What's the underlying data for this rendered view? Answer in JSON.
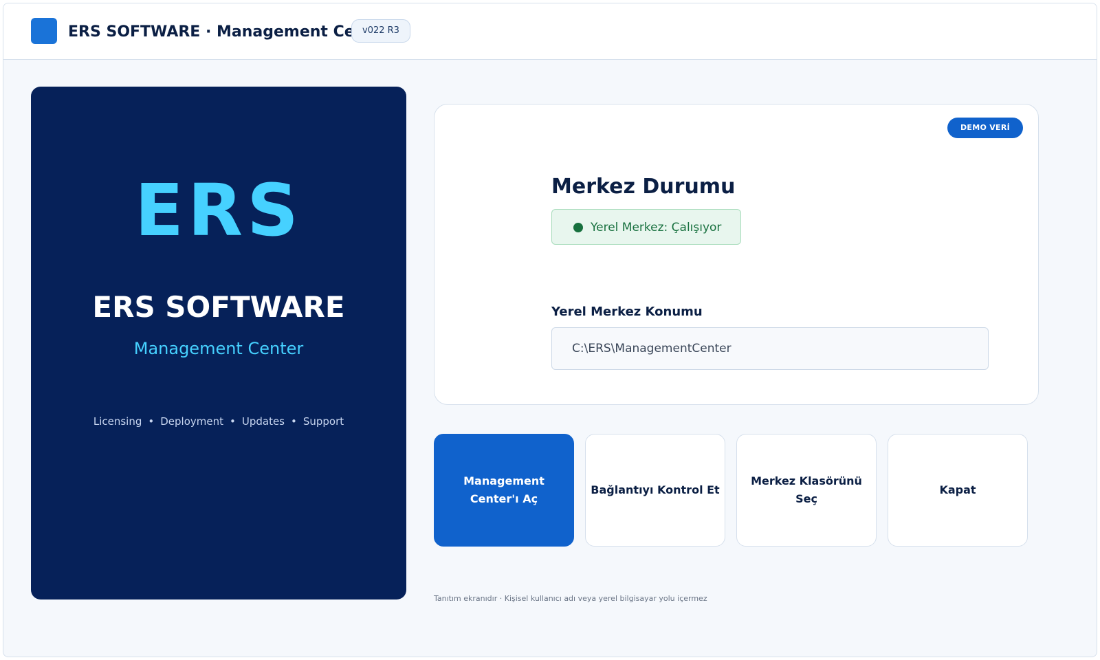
{
  "header": {
    "title": "ERS SOFTWARE · Management Center",
    "version": "v022 R3",
    "app_icon": "app-logo-square",
    "accent_color": "#1a73d8"
  },
  "brand": {
    "logo_text": "ERS",
    "name": "ERS SOFTWARE",
    "subtitle": "Management Center",
    "tags": [
      "Licensing",
      "Deployment",
      "Updates",
      "Support"
    ],
    "tag_separator": "•",
    "panel_color": "#062159",
    "logo_color": "#46d1ff"
  },
  "status_card": {
    "badge": "DEMO VERİ",
    "title": "Merkez Durumu",
    "status_text": "Yerel Merkez: Çalışıyor",
    "status_color": "#17703e",
    "location_label": "Yerel Merkez Konumu",
    "location_value": "C:\\ERS\\ManagementCenter"
  },
  "actions": {
    "open_label": "Management Center'ı Aç",
    "check_label": "Bağlantıyı Kontrol Et",
    "select_label": "Merkez Klasörünü Seç",
    "close_label": "Kapat",
    "primary_color": "#1062cc"
  },
  "footer": {
    "note": "Tanıtım ekranıdır · Kişisel kullanıcı adı veya yerel bilgisayar yolu içermez"
  }
}
